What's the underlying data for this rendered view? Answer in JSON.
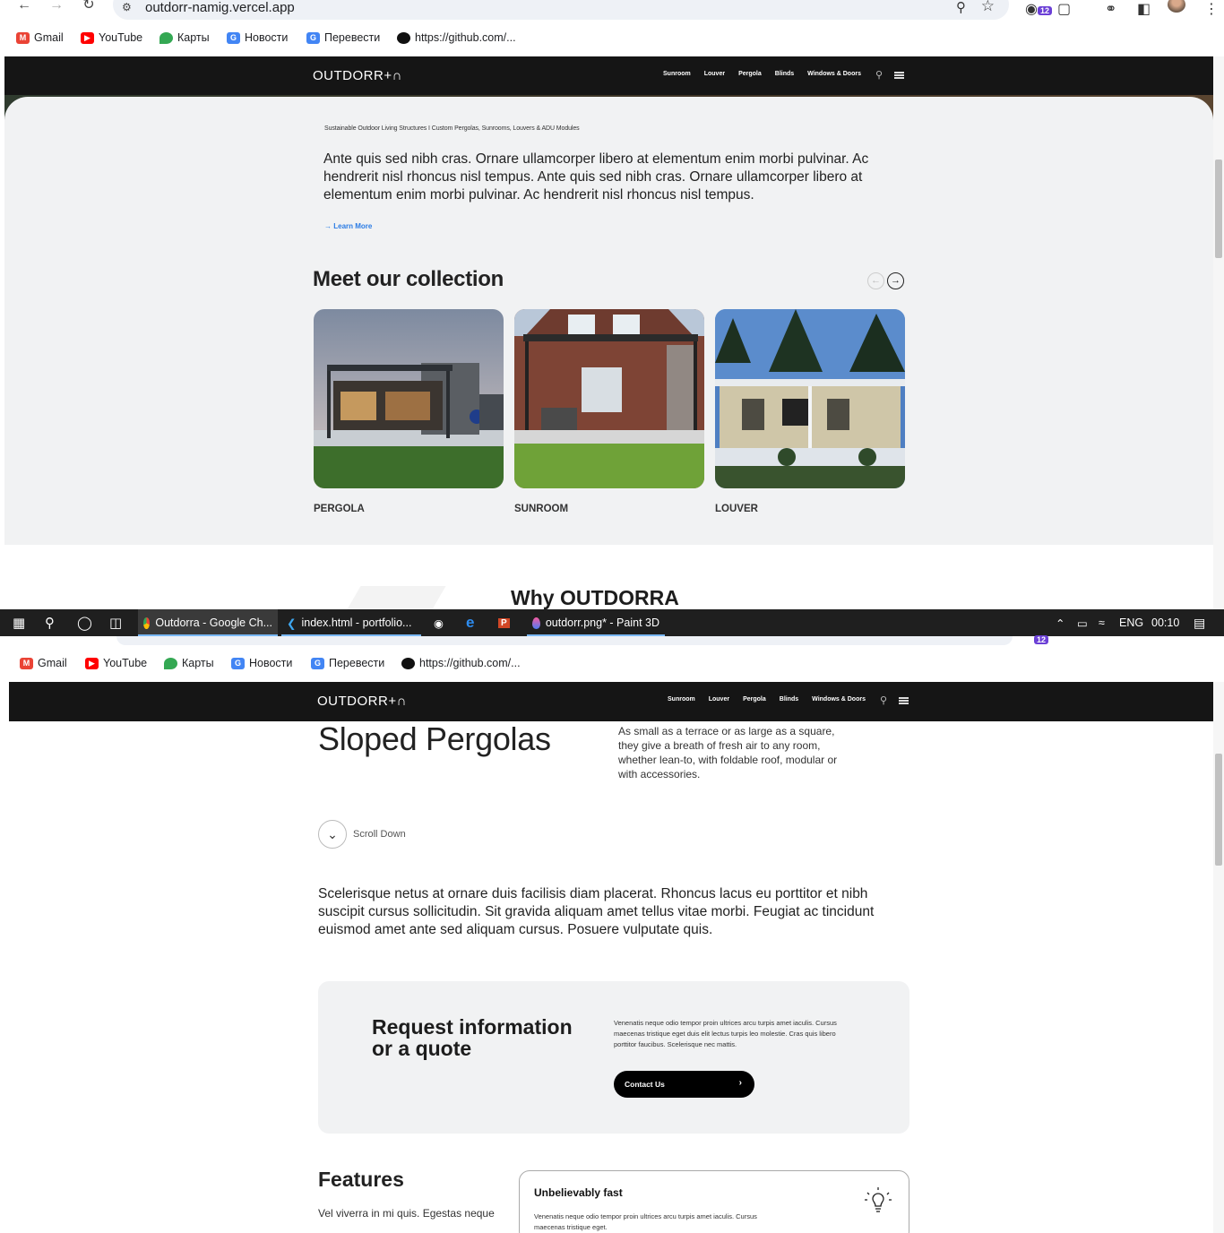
{
  "browser": {
    "url": "outdorr-namig.vercel.app",
    "extension_badge": "12"
  },
  "bookmarks": [
    {
      "label": "Gmail",
      "icon": "gmail-icon",
      "color": "#ea4335"
    },
    {
      "label": "YouTube",
      "icon": "youtube-icon",
      "color": "#ff0000"
    },
    {
      "label": "Карты",
      "icon": "maps-pin-icon",
      "color": "#34a853"
    },
    {
      "label": "Новости",
      "icon": "google-news-icon",
      "color": "#4285f4"
    },
    {
      "label": "Перевести",
      "icon": "translate-icon",
      "color": "#4285f4"
    },
    {
      "label": "https://github.com/...",
      "icon": "github-icon",
      "color": "#111111"
    }
  ],
  "site": {
    "logo": "OUTDORR+∩",
    "nav": [
      "Sunroom",
      "Louver",
      "Pergola",
      "Blinds",
      "Windows & Doors"
    ]
  },
  "intro": {
    "tagline": "Sustainable Outdoor Living Structures I Custom Pergolas, Sunrooms, Louvers & ADU Modules",
    "lead": "Ante quis sed nibh cras. Ornare ullamcorper libero at elementum enim morbi pulvinar. Ac hendrerit nisl rhoncus nisl tempus. Ante quis sed nibh cras. Ornare ullamcorper libero at elementum enim morbi pulvinar. Ac hendrerit nisl rhoncus nisl tempus.",
    "learn_more": "Learn More"
  },
  "collection": {
    "title": "Meet our collection",
    "items": [
      {
        "label": "PERGOLA"
      },
      {
        "label": "SUNROOM"
      },
      {
        "label": "LOUVER"
      }
    ]
  },
  "why": {
    "title": "Why OUTDORRA"
  },
  "taskbar": {
    "items": [
      {
        "label": "Outdorra - Google Ch..."
      },
      {
        "label": "index.html - portfolio..."
      },
      {
        "label": "outdorr.png* - Paint 3D"
      }
    ],
    "lang": "ENG",
    "time": "00:10"
  },
  "product": {
    "title": "Sloped Pergolas",
    "description": "As small as a terrace or as large as a square, they give a breath of fresh air to any room, whether lean-to, with foldable roof, modular or with accessories.",
    "scroll_down": "Scroll Down",
    "paragraph": "Scelerisque netus at ornare duis facilisis diam placerat. Rhoncus lacus eu porttitor et nibh suscipit cursus sollicitudin. Sit gravida aliquam amet tellus vitae morbi. Feugiat ac tincidunt euismod amet ante sed aliquam cursus. Posuere vulputate quis."
  },
  "quote": {
    "title": "Request information or a quote",
    "text": "Venenatis neque odio tempor proin ultrices arcu turpis amet iaculis. Cursus maecenas tristique eget duis elit lectus turpis leo molestie. Cras quis libero porttitor faucibus. Scelerisque nec mattis.",
    "button": "Contact Us"
  },
  "features": {
    "title": "Features",
    "subtitle": "Vel viverra in mi quis. Egestas neque",
    "card_title": "Unbelievably fast",
    "card_text": "Venenatis neque odio tempor proin ultrices arcu turpis amet iaculis. Cursus maecenas tristique eget."
  }
}
